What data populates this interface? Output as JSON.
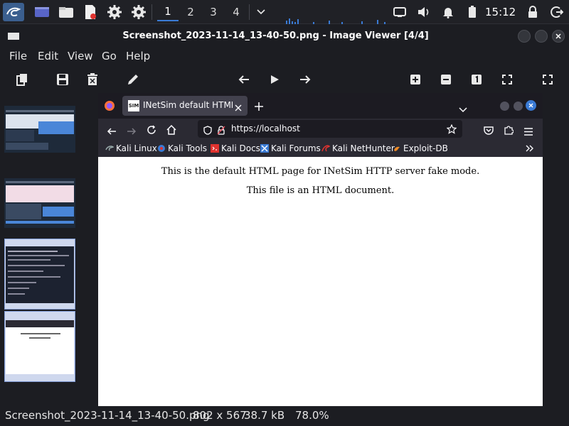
{
  "panel": {
    "workspaces": [
      "1",
      "2",
      "3",
      "4"
    ],
    "active_workspace": "1",
    "clock": "15:12"
  },
  "window": {
    "title": "Screenshot_2023-11-14_13-40-50.png - Image Viewer [4/4]"
  },
  "menu": [
    "File",
    "Edit",
    "View",
    "Go",
    "Help"
  ],
  "status": {
    "filename": "Screenshot_2023-11-14_13-40-50.png",
    "dimensions": "802 x 567",
    "size": "38.7 kB",
    "zoom": "78.0%"
  },
  "browser": {
    "tab_title": "INetSim default HTML pa",
    "tab_icon_text": "SIM",
    "url": "https://localhost",
    "bookmarks": [
      "Kali Linux",
      "Kali Tools",
      "Kali Docs",
      "Kali Forums",
      "Kali NetHunter",
      "Exploit-DB"
    ],
    "page_line1": "This is the default HTML page for INetSim HTTP server fake mode.",
    "page_line2": "This file is an HTML document."
  },
  "colors": {
    "accent": "#3a7bd5",
    "panel_bg": "#202126",
    "window_bg": "#1c1d22"
  }
}
